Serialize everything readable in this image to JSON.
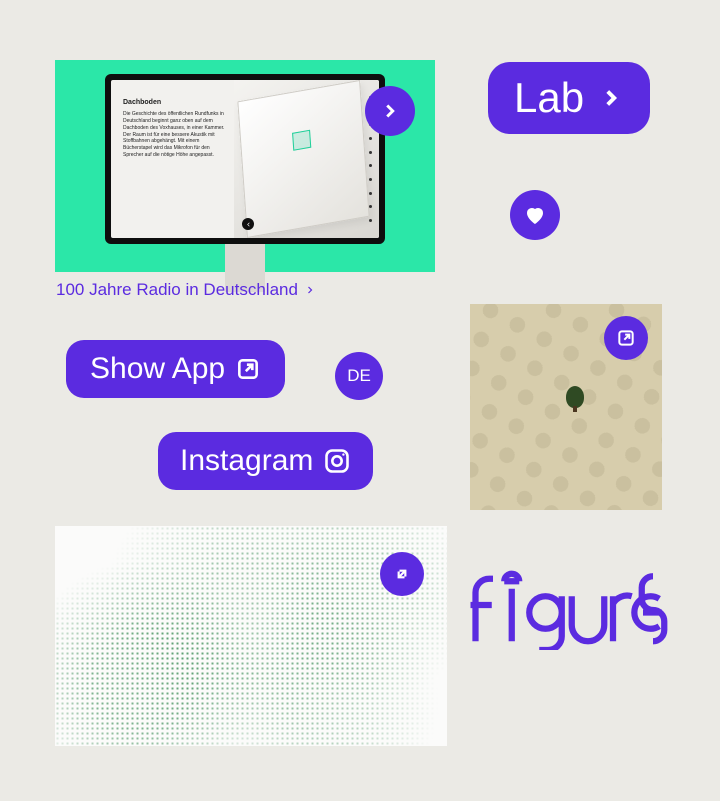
{
  "colors": {
    "accent": "#5b2be0",
    "mint": "#2be7a8",
    "page_bg": "#ebeae5",
    "forest_bg": "#d7cdac",
    "dotmap_dot": "#187838"
  },
  "monitor_card": {
    "heading": "Dachboden",
    "body": "Die Geschichte des öffentlichen Rundfunks in Deutschland beginnt ganz oben auf dem Dachboden des Voxhauses, in einer Kammer. Der Raum ist für eine bessere Akustik mit Stoffbahnen abgehängt. Mit einem Bücherstapel wird das Mikrofon für den Sprecher auf die nötige Höhe angepasst.",
    "caption": "100 Jahre Radio in Deutschland",
    "next_icon": "chevron-right-icon",
    "back_icon": "chevron-left-icon"
  },
  "lab_button": {
    "label": "Lab",
    "icon": "chevron-right-icon"
  },
  "heart_button": {
    "icon": "heart-icon"
  },
  "show_app_button": {
    "label": "Show App",
    "icon": "external-link-icon"
  },
  "lang_button": {
    "label": "DE"
  },
  "instagram_button": {
    "label": "Instagram",
    "icon": "instagram-icon"
  },
  "forest_tile": {
    "open_icon": "external-link-icon"
  },
  "dotmap_tile": {
    "expand_icon": "expand-icon"
  },
  "figures_logotype": {
    "text": "figures"
  }
}
